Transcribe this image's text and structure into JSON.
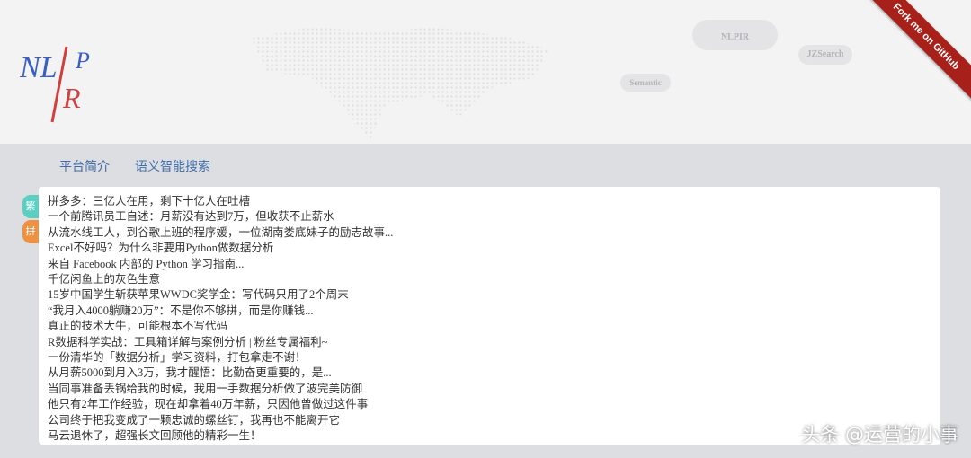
{
  "header": {
    "logo_text": "NLPIR",
    "clouds": [
      "NLPIR",
      "JZSearch",
      "Semantic"
    ],
    "ribbon": "Fork me on GitHub"
  },
  "nav": [
    "平台简介",
    "语义智能搜索"
  ],
  "side_tabs": [
    {
      "label": "繁",
      "color": "#5bcfc2"
    },
    {
      "label": "拼",
      "color": "#ef9140"
    }
  ],
  "lines": [
    "拼多多：三亿人在用，剩下十亿人在吐槽",
    " 一个前腾讯员工自述：月薪没有达到7万，但收获不止薪水",
    "从流水线工人，到谷歌上班的程序媛，一位湖南娄底妹子的励志故事...",
    " Excel不好吗？为什么非要用Python做数据分析",
    " 来自 Facebook 内部的 Python 学习指南...",
    " 千亿闲鱼上的灰色生意",
    "15岁中国学生斩获苹果WWDC奖学金：写代码只用了2个周末",
    "“我月入4000躺赚20万”：不是你不够拼，而是你赚钱...",
    " 真正的技术大牛，可能根本不写代码",
    " R数据科学实战：工具箱详解与案例分析 | 粉丝专属福利~",
    " 一份清华的「数据分析」学习资料，打包拿走不谢！",
    " 从月薪5000到月入3万，我才醒悟：比勤奋更重要的，是...",
    " 当同事准备丢锅给我的时候，我用一手数据分析做了波完美防御",
    " 他只有2年工作经验，现在却拿着40万年薪，只因他曾做过这件事",
    " 公司终于把我变成了一颗忠诚的螺丝钉，我再也不能离开它",
    " 马云退休了，超强长文回顾他的精彩一生！"
  ],
  "watermark": "头条 @运营的小事"
}
